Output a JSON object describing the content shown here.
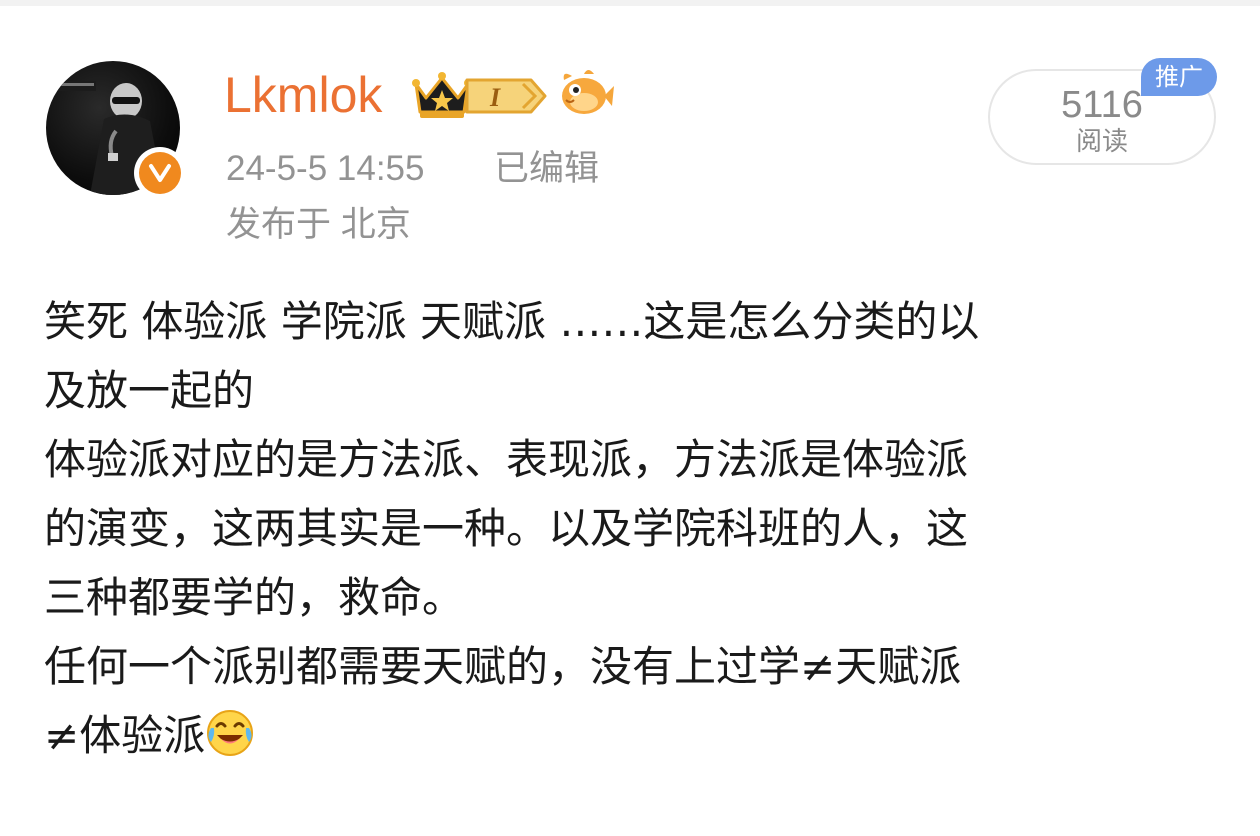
{
  "post": {
    "username": "Lkmlok",
    "timestamp": "24-5-5 14:55",
    "edited_label": "已编辑",
    "location": "发布于 北京",
    "views": {
      "count": "5116",
      "label": "阅读"
    },
    "promo_label": "推广",
    "level_badge": "I",
    "body_lines": [
      "笑死 体验派 学院派 天赋派 ……这是怎么分类的以",
      "及放一起的",
      "体验派对应的是方法派、表现派，方法派是体验派",
      "的演变，这两其实是一种。以及学院科班的人，这",
      "三种都要学的，救命。",
      "任何一个派别都需要天赋的，没有上过学≠天赋派",
      "≠体验派"
    ],
    "icons": {
      "verified": "verified-v-icon",
      "crown": "crown-icon",
      "fish": "fish-icon",
      "emoji": "laughing-crying-emoji-icon"
    },
    "colors": {
      "username": "#eb7133",
      "verified": "#f0891e",
      "promo": "#6d9ae9",
      "meta": "#939393"
    }
  }
}
